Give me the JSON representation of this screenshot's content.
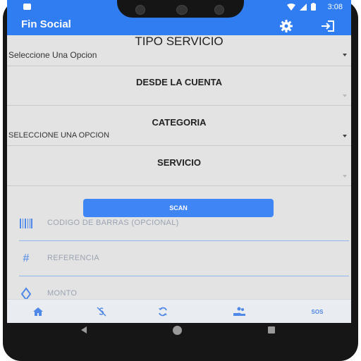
{
  "status_bar": {
    "time": "3:08"
  },
  "app_bar": {
    "title": "Fin Social"
  },
  "form": {
    "tipo_servicio": {
      "label": "TIPO SERVICIO",
      "value": "Seleccione Una Opcion"
    },
    "desde_cuenta": {
      "label": "DESDE LA CUENTA",
      "value": ""
    },
    "categoria": {
      "label": "CATEGORIA",
      "value": "SELECCIONE UNA OPCION"
    },
    "servicio": {
      "label": "SERVICIO",
      "value": ""
    },
    "scan_label": "SCAN",
    "codigo_barras": {
      "placeholder": "CODIGO DE BARRAS (OPCIONAL)"
    },
    "referencia": {
      "placeholder": "REFERENCIA"
    },
    "monto": {
      "placeholder": "MONTO"
    }
  },
  "bottom_nav": {
    "items": [
      {
        "icon": "home-icon"
      },
      {
        "icon": "no-money-icon"
      },
      {
        "icon": "refresh-icon"
      },
      {
        "icon": "hand-coins-icon"
      },
      {
        "label": "SOS"
      }
    ]
  },
  "colors": {
    "primary": "#2f7df0",
    "accent_icon": "#4f88e6",
    "scan_button": "#3f86f4",
    "background": "#e3e3e3"
  }
}
